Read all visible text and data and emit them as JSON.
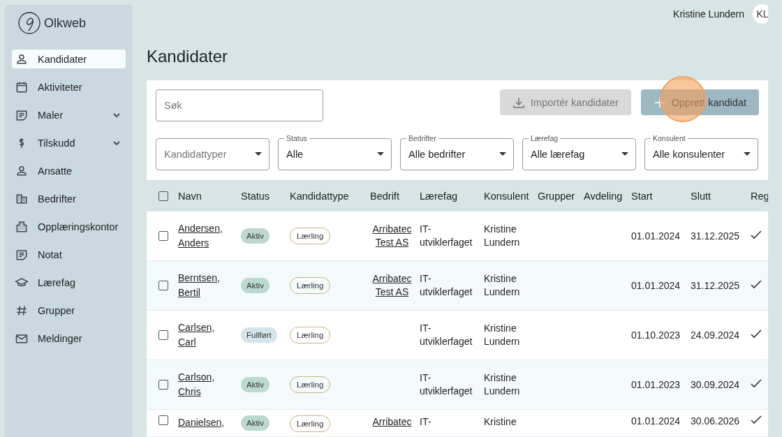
{
  "sidebar": {
    "logo": "Olkweb",
    "items": [
      {
        "label": "Kandidater",
        "kind": "link",
        "selected": true
      },
      {
        "label": "Aktiviteter",
        "kind": "link",
        "selected": false
      },
      {
        "label": "Maler",
        "kind": "group",
        "selected": false
      },
      {
        "label": "Tilskudd",
        "kind": "group",
        "selected": false
      },
      {
        "label": "Ansatte",
        "kind": "link",
        "selected": false
      },
      {
        "label": "Bedrifter",
        "kind": "link",
        "selected": false
      },
      {
        "label": "Opplæringskontor",
        "kind": "link",
        "selected": false
      },
      {
        "label": "Notat",
        "kind": "link",
        "selected": false
      },
      {
        "label": "Lærefag",
        "kind": "link",
        "selected": false
      },
      {
        "label": "Grupper",
        "kind": "link",
        "selected": false
      },
      {
        "label": "Meldinger",
        "kind": "link",
        "selected": false
      }
    ]
  },
  "header": {
    "user_name": "Kristine Lundern",
    "avatar_initials": "KL"
  },
  "page_title": "Kandidater",
  "toolbar": {
    "search": {
      "placeholder": "Søk"
    },
    "buttons": [
      {
        "label": "Importér kandidater",
        "kind": "import",
        "disabled": true
      },
      {
        "label": "Opprett kandidat",
        "kind": "create",
        "disabled": false
      }
    ],
    "filters": [
      {
        "placeholder": "Kandidattyper"
      },
      {
        "label": "Status",
        "value": "Alle"
      },
      {
        "label": "Bedrifter",
        "value": "Alle bedrifter"
      },
      {
        "label": "Lærefag",
        "value": "Alle lærefag"
      },
      {
        "label": "Konsulent",
        "value": "Alle konsulenter"
      }
    ]
  },
  "table": {
    "select_all": {
      "checked": false
    },
    "columns": [
      "Navn",
      "Status",
      "Kandidattype",
      "Bedrift",
      "Lærefag",
      "Konsulent",
      "Grupper",
      "Avdeling",
      "Start",
      "Slutt",
      "Reg"
    ],
    "rows": [
      {
        "checked": false,
        "name": "Andersen, Anders",
        "status": {
          "label": "Aktiv",
          "color": "#bcd9cf"
        },
        "type": "Lærling",
        "company": "Arribatec Test AS",
        "subject": "IT-utviklerfaget",
        "consultant": "Kristine Lundern",
        "start": "01.01.2024",
        "end": "31.12.2025",
        "registered": true
      },
      {
        "checked": false,
        "name": "Berntsen, Bertil",
        "status": {
          "label": "Aktiv",
          "color": "#bcd9cf"
        },
        "type": "Lærling",
        "company": "Arribatec Test AS",
        "subject": "IT-utviklerfaget",
        "consultant": "Kristine Lundern",
        "start": "01.01.2024",
        "end": "31.12.2025",
        "registered": true
      },
      {
        "checked": false,
        "name": "Carlsen, Carl",
        "status": {
          "label": "Fullført",
          "color": "#d3e4ec"
        },
        "type": "Lærling",
        "company": "",
        "subject": "IT-utviklerfaget",
        "consultant": "Kristine Lundern",
        "start": "01.10.2023",
        "end": "24.09.2024",
        "registered": true
      },
      {
        "checked": false,
        "name": "Carlson, Chris",
        "status": {
          "label": "Aktiv",
          "color": "#bcd9cf"
        },
        "type": "Lærling",
        "company": "",
        "subject": "IT-utviklerfaget",
        "consultant": "Kristine Lundern",
        "start": "01.01.2023",
        "end": "30.09.2024",
        "registered": true
      },
      {
        "checked": false,
        "name": "Danielsen,",
        "status": {
          "label": "Aktiv",
          "color": "#bcd9cf"
        },
        "type": "Lærling",
        "company": "Arribatec",
        "subject": "IT-",
        "consultant": "Kristine",
        "start": "01.01.2024",
        "end": "30.06.2026",
        "registered": true
      }
    ]
  }
}
